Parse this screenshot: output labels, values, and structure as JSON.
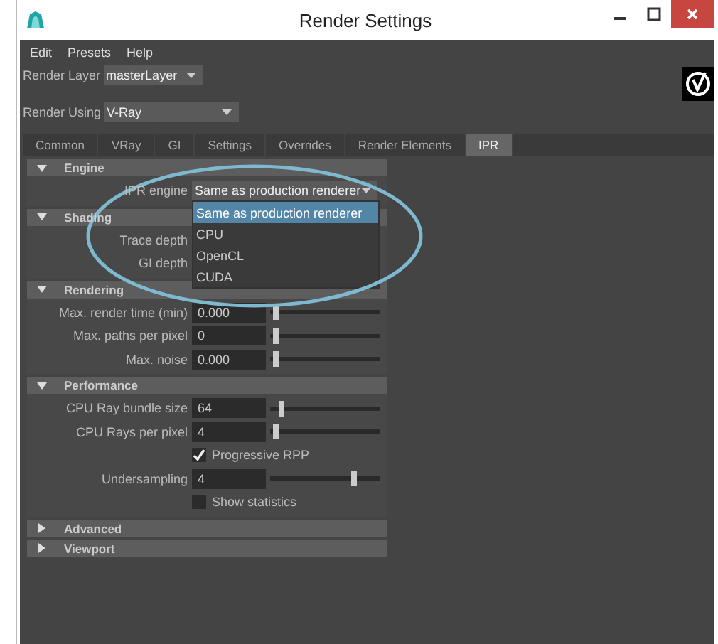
{
  "window": {
    "title": "Render Settings"
  },
  "menu": [
    "Edit",
    "Presets",
    "Help"
  ],
  "render_layer": {
    "label": "Render Layer",
    "value": "masterLayer"
  },
  "render_using": {
    "label": "Render Using",
    "value": "V-Ray"
  },
  "tabs": [
    {
      "label": "Common",
      "selected": false
    },
    {
      "label": "VRay",
      "selected": false
    },
    {
      "label": "GI",
      "selected": false
    },
    {
      "label": "Settings",
      "selected": false
    },
    {
      "label": "Overrides",
      "selected": false
    },
    {
      "label": "Render Elements",
      "selected": false
    },
    {
      "label": "IPR",
      "selected": true
    }
  ],
  "sections": [
    {
      "title": "Engine",
      "expanded": true,
      "rows": [
        {
          "kind": "dropdown",
          "label": "IPR engine",
          "value": "Same as production renderer",
          "open": true,
          "options": [
            {
              "label": "Same as production renderer",
              "selected": true
            },
            {
              "label": "CPU",
              "selected": false
            },
            {
              "label": "OpenCL",
              "selected": false
            },
            {
              "label": "CUDA",
              "selected": false
            }
          ]
        }
      ]
    },
    {
      "title": "Shading",
      "expanded": true,
      "rows": [
        {
          "kind": "hidden_field",
          "label": "Trace depth"
        },
        {
          "kind": "hidden_field",
          "label": "GI depth"
        }
      ]
    },
    {
      "title": "Rendering",
      "expanded": true,
      "rows": [
        {
          "kind": "slider",
          "label": "Max. render time (min)",
          "value": "0.000",
          "level": 0.05
        },
        {
          "kind": "slider",
          "label": "Max. paths per pixel",
          "value": "0",
          "level": 0.05
        },
        {
          "kind": "slider",
          "label": "Max. noise",
          "value": "0.000",
          "level": 0.05
        }
      ]
    },
    {
      "title": "Performance",
      "expanded": true,
      "rows": [
        {
          "kind": "slider",
          "label": "CPU Ray bundle size",
          "value": "64",
          "level": 0.1
        },
        {
          "kind": "slider",
          "label": "CPU Rays per pixel",
          "value": "4",
          "level": 0.05
        },
        {
          "kind": "checkbox",
          "label": "Progressive RPP",
          "checked": true
        },
        {
          "kind": "slider",
          "label": "Undersampling",
          "value": "4",
          "level": 0.77
        },
        {
          "kind": "checkbox",
          "label": "Show statistics",
          "checked": false
        }
      ]
    },
    {
      "title": "Advanced",
      "expanded": false
    },
    {
      "title": "Viewport",
      "expanded": false
    }
  ]
}
